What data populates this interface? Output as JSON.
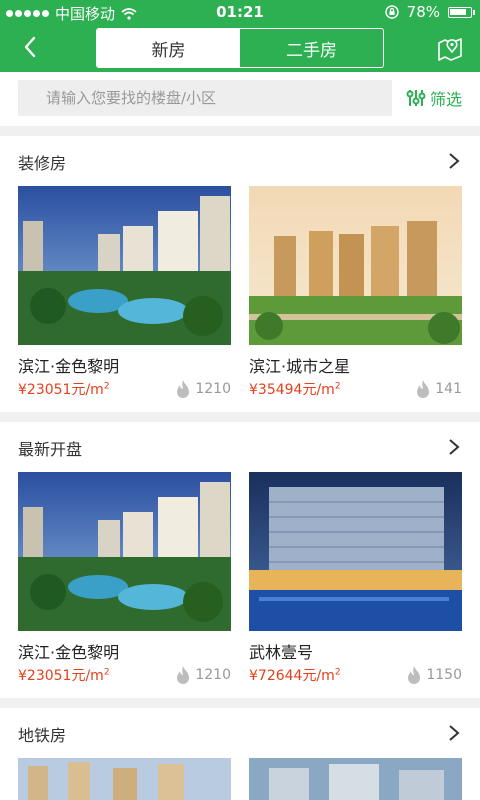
{
  "status": {
    "carrier": "中国移动",
    "time": "01:21",
    "battery": "78%"
  },
  "header": {
    "tabs": [
      "新房",
      "二手房"
    ],
    "active_tab": "新房"
  },
  "search": {
    "placeholder": "请输入您要找的楼盘/小区",
    "filter_label": "筛选"
  },
  "sections": [
    {
      "title": "装修房",
      "cards": [
        {
          "name": "滨江·金色黎明",
          "price": "¥23051元/m",
          "price_sup": "2",
          "views": "1210"
        },
        {
          "name": "滨江·城市之星",
          "price": "¥35494元/m",
          "price_sup": "2",
          "views": "141"
        }
      ]
    },
    {
      "title": "最新开盘",
      "cards": [
        {
          "name": "滨江·金色黎明",
          "price": "¥23051元/m",
          "price_sup": "2",
          "views": "1210"
        },
        {
          "name": "武林壹号",
          "price": "¥72644元/m",
          "price_sup": "2",
          "views": "1150"
        }
      ]
    },
    {
      "title": "地铁房",
      "cards": []
    }
  ],
  "colors": {
    "brand": "#2db052",
    "price": "#e4401b"
  }
}
